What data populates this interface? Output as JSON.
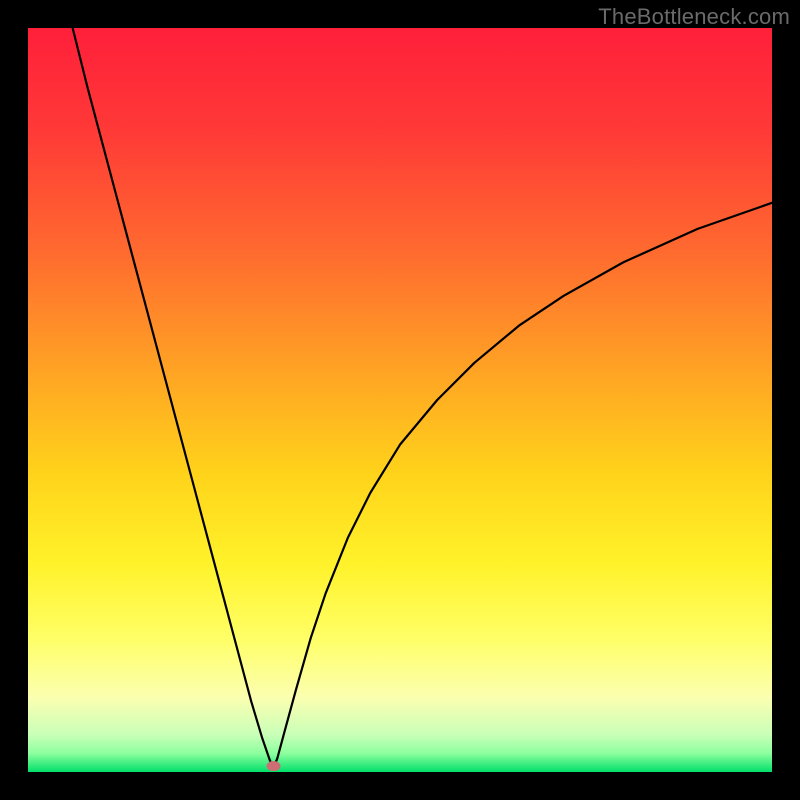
{
  "watermark": "TheBottleneck.com",
  "chart_data": {
    "type": "line",
    "title": "",
    "xlabel": "",
    "ylabel": "",
    "xlim": [
      0,
      100
    ],
    "ylim": [
      0,
      100
    ],
    "grid": false,
    "legend": false,
    "gradient_stops": [
      {
        "offset": 0.0,
        "color": "#ff1f3a"
      },
      {
        "offset": 0.14,
        "color": "#ff3a37"
      },
      {
        "offset": 0.3,
        "color": "#ff6a2f"
      },
      {
        "offset": 0.46,
        "color": "#ffa324"
      },
      {
        "offset": 0.6,
        "color": "#ffd31a"
      },
      {
        "offset": 0.72,
        "color": "#fff22a"
      },
      {
        "offset": 0.82,
        "color": "#ffff66"
      },
      {
        "offset": 0.9,
        "color": "#fbffb0"
      },
      {
        "offset": 0.95,
        "color": "#c9ffb8"
      },
      {
        "offset": 0.975,
        "color": "#8cff9e"
      },
      {
        "offset": 1.0,
        "color": "#00e06a"
      }
    ],
    "marker": {
      "x": 33.0,
      "y": 0.8,
      "color": "#cc6e73"
    },
    "series": [
      {
        "name": "curve",
        "color": "#000000",
        "stroke_width": 2.2,
        "x": [
          6.0,
          8.0,
          10.0,
          12.0,
          14.0,
          16.0,
          18.0,
          20.0,
          22.0,
          24.0,
          26.0,
          28.0,
          30.0,
          31.5,
          32.5,
          33.0,
          33.5,
          34.5,
          36.0,
          38.0,
          40.0,
          43.0,
          46.0,
          50.0,
          55.0,
          60.0,
          66.0,
          72.0,
          80.0,
          90.0,
          100.0
        ],
        "y": [
          100.0,
          92.0,
          84.5,
          77.0,
          69.5,
          62.0,
          54.5,
          47.0,
          39.5,
          32.0,
          24.5,
          17.0,
          9.5,
          4.5,
          1.6,
          0.6,
          1.8,
          5.5,
          11.0,
          18.0,
          24.0,
          31.5,
          37.5,
          44.0,
          50.0,
          55.0,
          60.0,
          64.0,
          68.5,
          73.0,
          76.5
        ]
      }
    ]
  }
}
